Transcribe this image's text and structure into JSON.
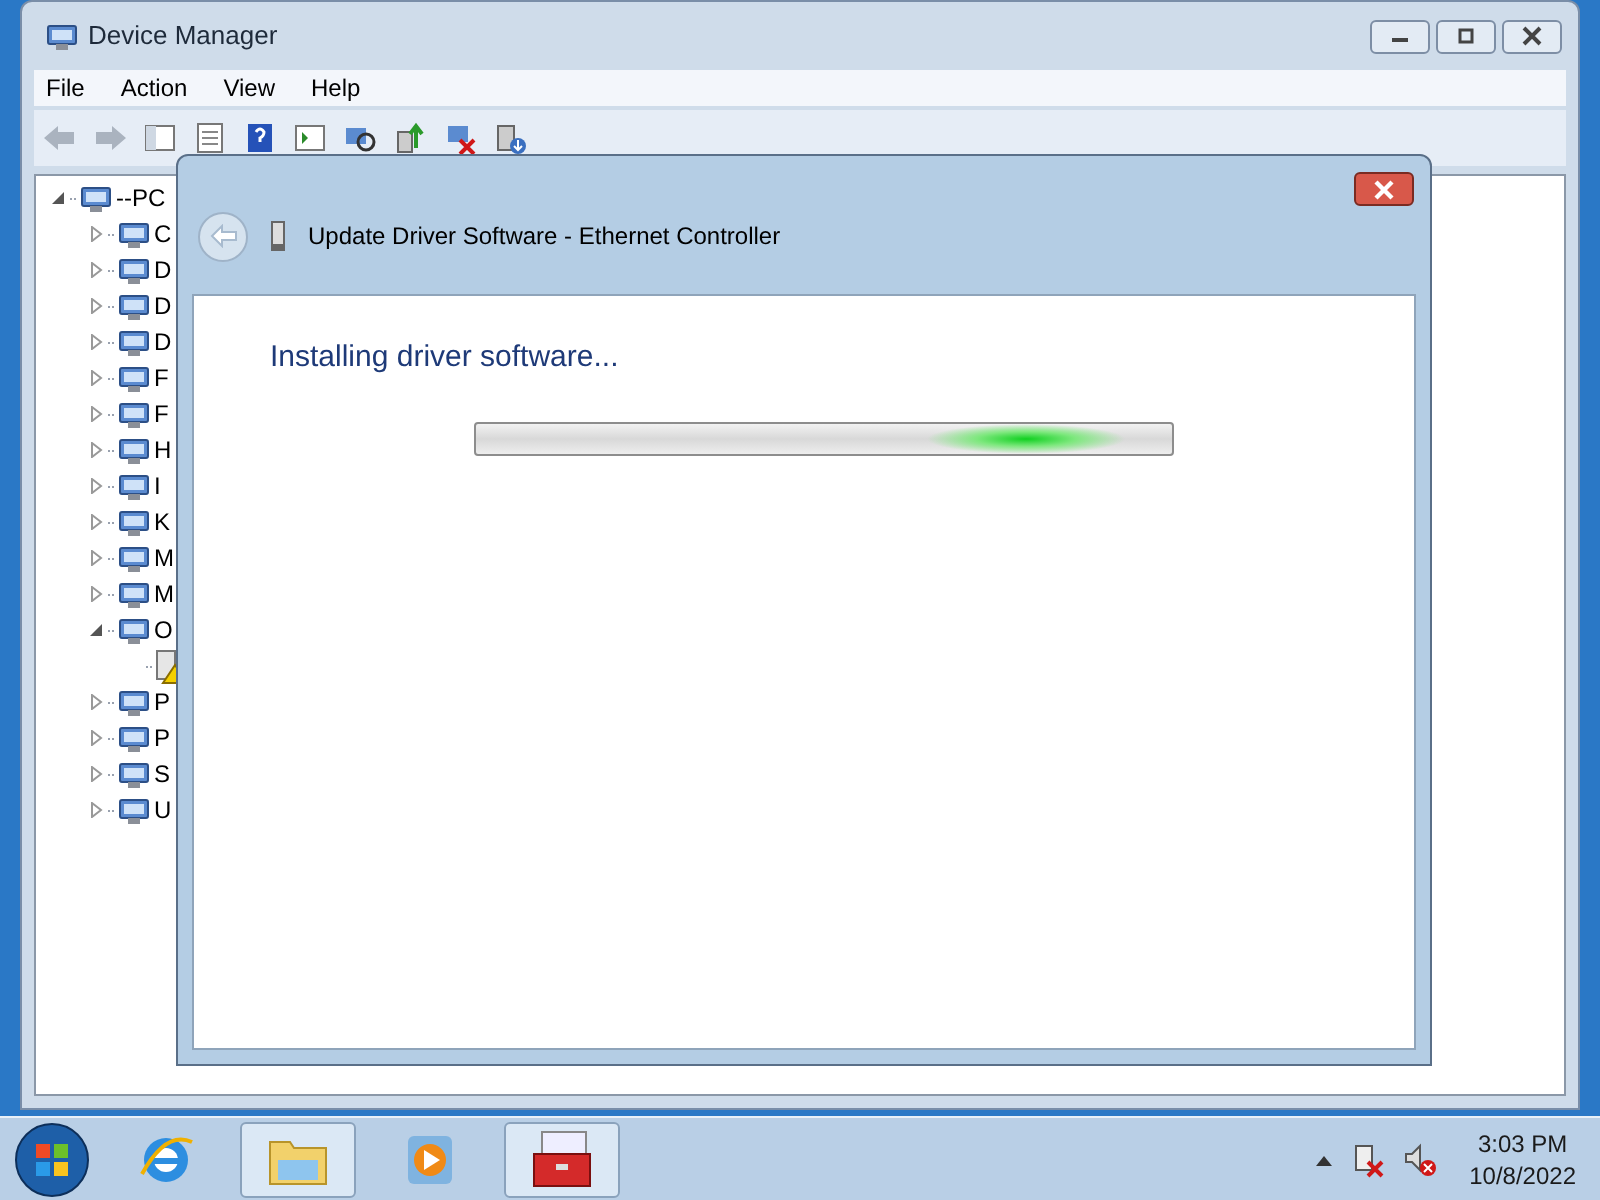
{
  "window": {
    "title": "Device Manager"
  },
  "menu": [
    "File",
    "Action",
    "View",
    "Help"
  ],
  "tree": [
    {
      "label": "--PC",
      "expanded": true,
      "children": [
        {
          "label": "C",
          "expanded": false
        },
        {
          "label": "D",
          "expanded": false
        },
        {
          "label": "D",
          "expanded": false
        },
        {
          "label": "D",
          "expanded": false
        },
        {
          "label": "F",
          "expanded": false
        },
        {
          "label": "F",
          "expanded": false
        },
        {
          "label": "H",
          "expanded": false
        },
        {
          "label": "I",
          "expanded": false
        },
        {
          "label": "K",
          "expanded": false
        },
        {
          "label": "M",
          "expanded": false
        },
        {
          "label": "M",
          "expanded": false
        },
        {
          "label": "O",
          "expanded": true,
          "children": [
            {
              "warning": true
            }
          ]
        },
        {
          "label": "P",
          "expanded": false
        },
        {
          "label": "P",
          "expanded": false
        },
        {
          "label": "S",
          "expanded": false
        },
        {
          "label": "U",
          "expanded": false
        }
      ]
    }
  ],
  "dialog": {
    "title": "Update Driver Software - Ethernet Controller",
    "heading": "Installing driver software...",
    "progress": {
      "indeterminate": true
    }
  },
  "taskbar": {
    "items": [
      {
        "kind": "browser",
        "running": false
      },
      {
        "kind": "folder",
        "running": true
      },
      {
        "kind": "media",
        "running": false
      },
      {
        "kind": "toolbox",
        "running": true
      }
    ],
    "clock": {
      "time": "3:03 PM",
      "date": "10/8/2022"
    }
  }
}
